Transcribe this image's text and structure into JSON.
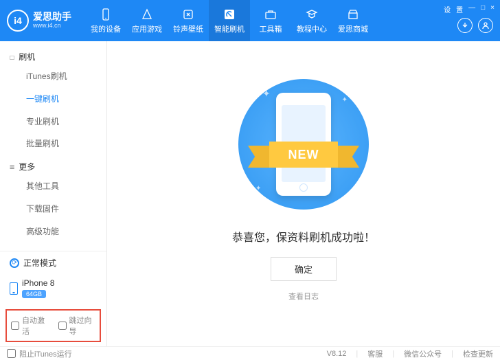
{
  "header": {
    "logo_badge": "i4",
    "logo_cn": "爱思助手",
    "logo_url": "www.i4.cn",
    "nav": [
      {
        "label": "我的设备"
      },
      {
        "label": "应用游戏"
      },
      {
        "label": "铃声壁纸"
      },
      {
        "label": "智能刷机",
        "active": true
      },
      {
        "label": "工具箱"
      },
      {
        "label": "教程中心"
      },
      {
        "label": "爱思商城"
      }
    ],
    "win_controls": [
      "设",
      "置",
      "—",
      "□",
      "×"
    ]
  },
  "sidebar": {
    "groups": [
      {
        "title": "刷机",
        "items": [
          {
            "label": "iTunes刷机"
          },
          {
            "label": "一键刷机",
            "active": true
          },
          {
            "label": "专业刷机"
          },
          {
            "label": "批量刷机"
          }
        ]
      },
      {
        "title": "更多",
        "items": [
          {
            "label": "其他工具"
          },
          {
            "label": "下载固件"
          },
          {
            "label": "高级功能"
          }
        ]
      }
    ],
    "mode_label": "正常模式",
    "device_name": "iPhone 8",
    "device_storage": "64GB",
    "checkboxes": [
      {
        "label": "自动激活"
      },
      {
        "label": "跳过向导"
      }
    ]
  },
  "main": {
    "ribbon_text": "NEW",
    "success_text": "恭喜您，保资料刷机成功啦！",
    "ok_button": "确定",
    "log_link": "查看日志"
  },
  "footer": {
    "block_itunes": "阻止iTunes运行",
    "version": "V8.12",
    "support": "客服",
    "wechat": "微信公众号",
    "update": "检查更新"
  }
}
